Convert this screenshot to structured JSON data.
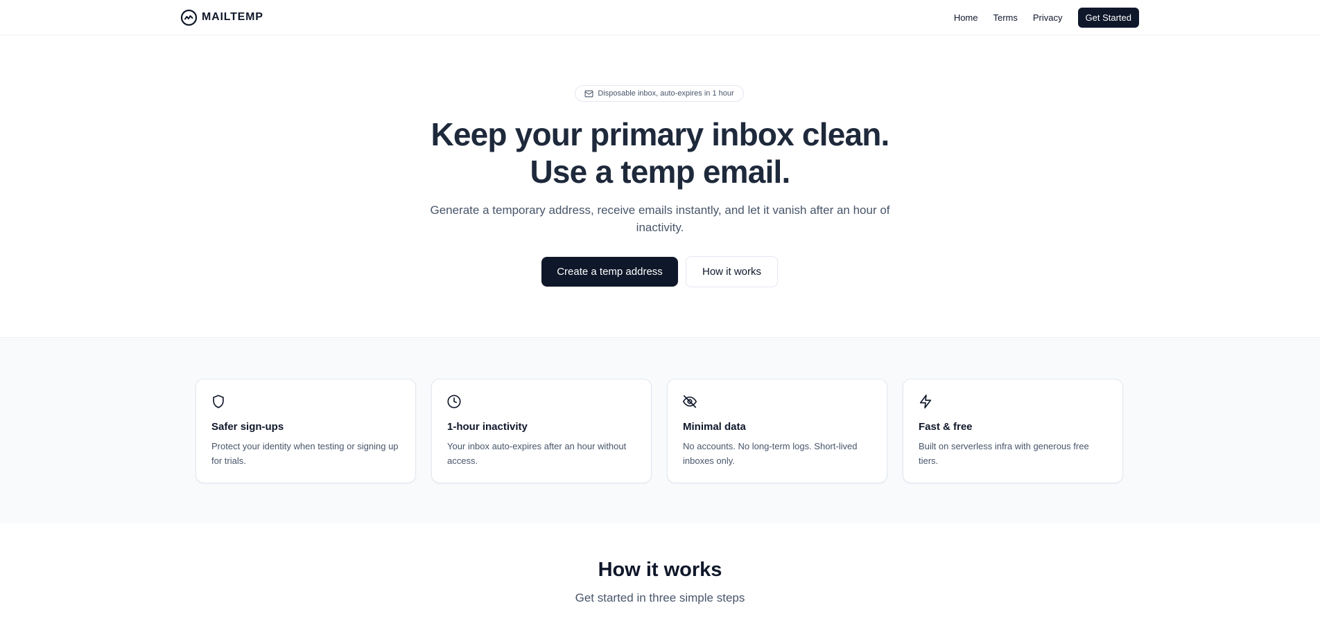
{
  "header": {
    "brand": "MAILTEMP",
    "nav": [
      "Home",
      "Terms",
      "Privacy"
    ],
    "cta": "Get Started"
  },
  "hero": {
    "badge": "Disposable inbox, auto-expires in 1 hour",
    "title_line1": "Keep your primary inbox clean.",
    "title_line2": "Use a temp email.",
    "subtitle": "Generate a temporary address, receive emails instantly, and let it vanish after an hour of inactivity.",
    "primary_button": "Create a temp address",
    "secondary_button": "How it works"
  },
  "features": [
    {
      "icon": "shield-icon",
      "title": "Safer sign-ups",
      "description": "Protect your identity when testing or signing up for trials."
    },
    {
      "icon": "clock-icon",
      "title": "1-hour inactivity",
      "description": "Your inbox auto-expires after an hour without access."
    },
    {
      "icon": "eye-off-icon",
      "title": "Minimal data",
      "description": "No accounts. No long-term logs. Short-lived inboxes only."
    },
    {
      "icon": "zap-icon",
      "title": "Fast & free",
      "description": "Built on serverless infra with generous free tiers."
    }
  ],
  "how_it_works": {
    "title": "How it works",
    "subtitle": "Get started in three simple steps"
  },
  "colors": {
    "primary": "#0f172a",
    "muted_text": "#475569",
    "section_bg": "#f8fafc",
    "border": "#e2e8f0"
  }
}
